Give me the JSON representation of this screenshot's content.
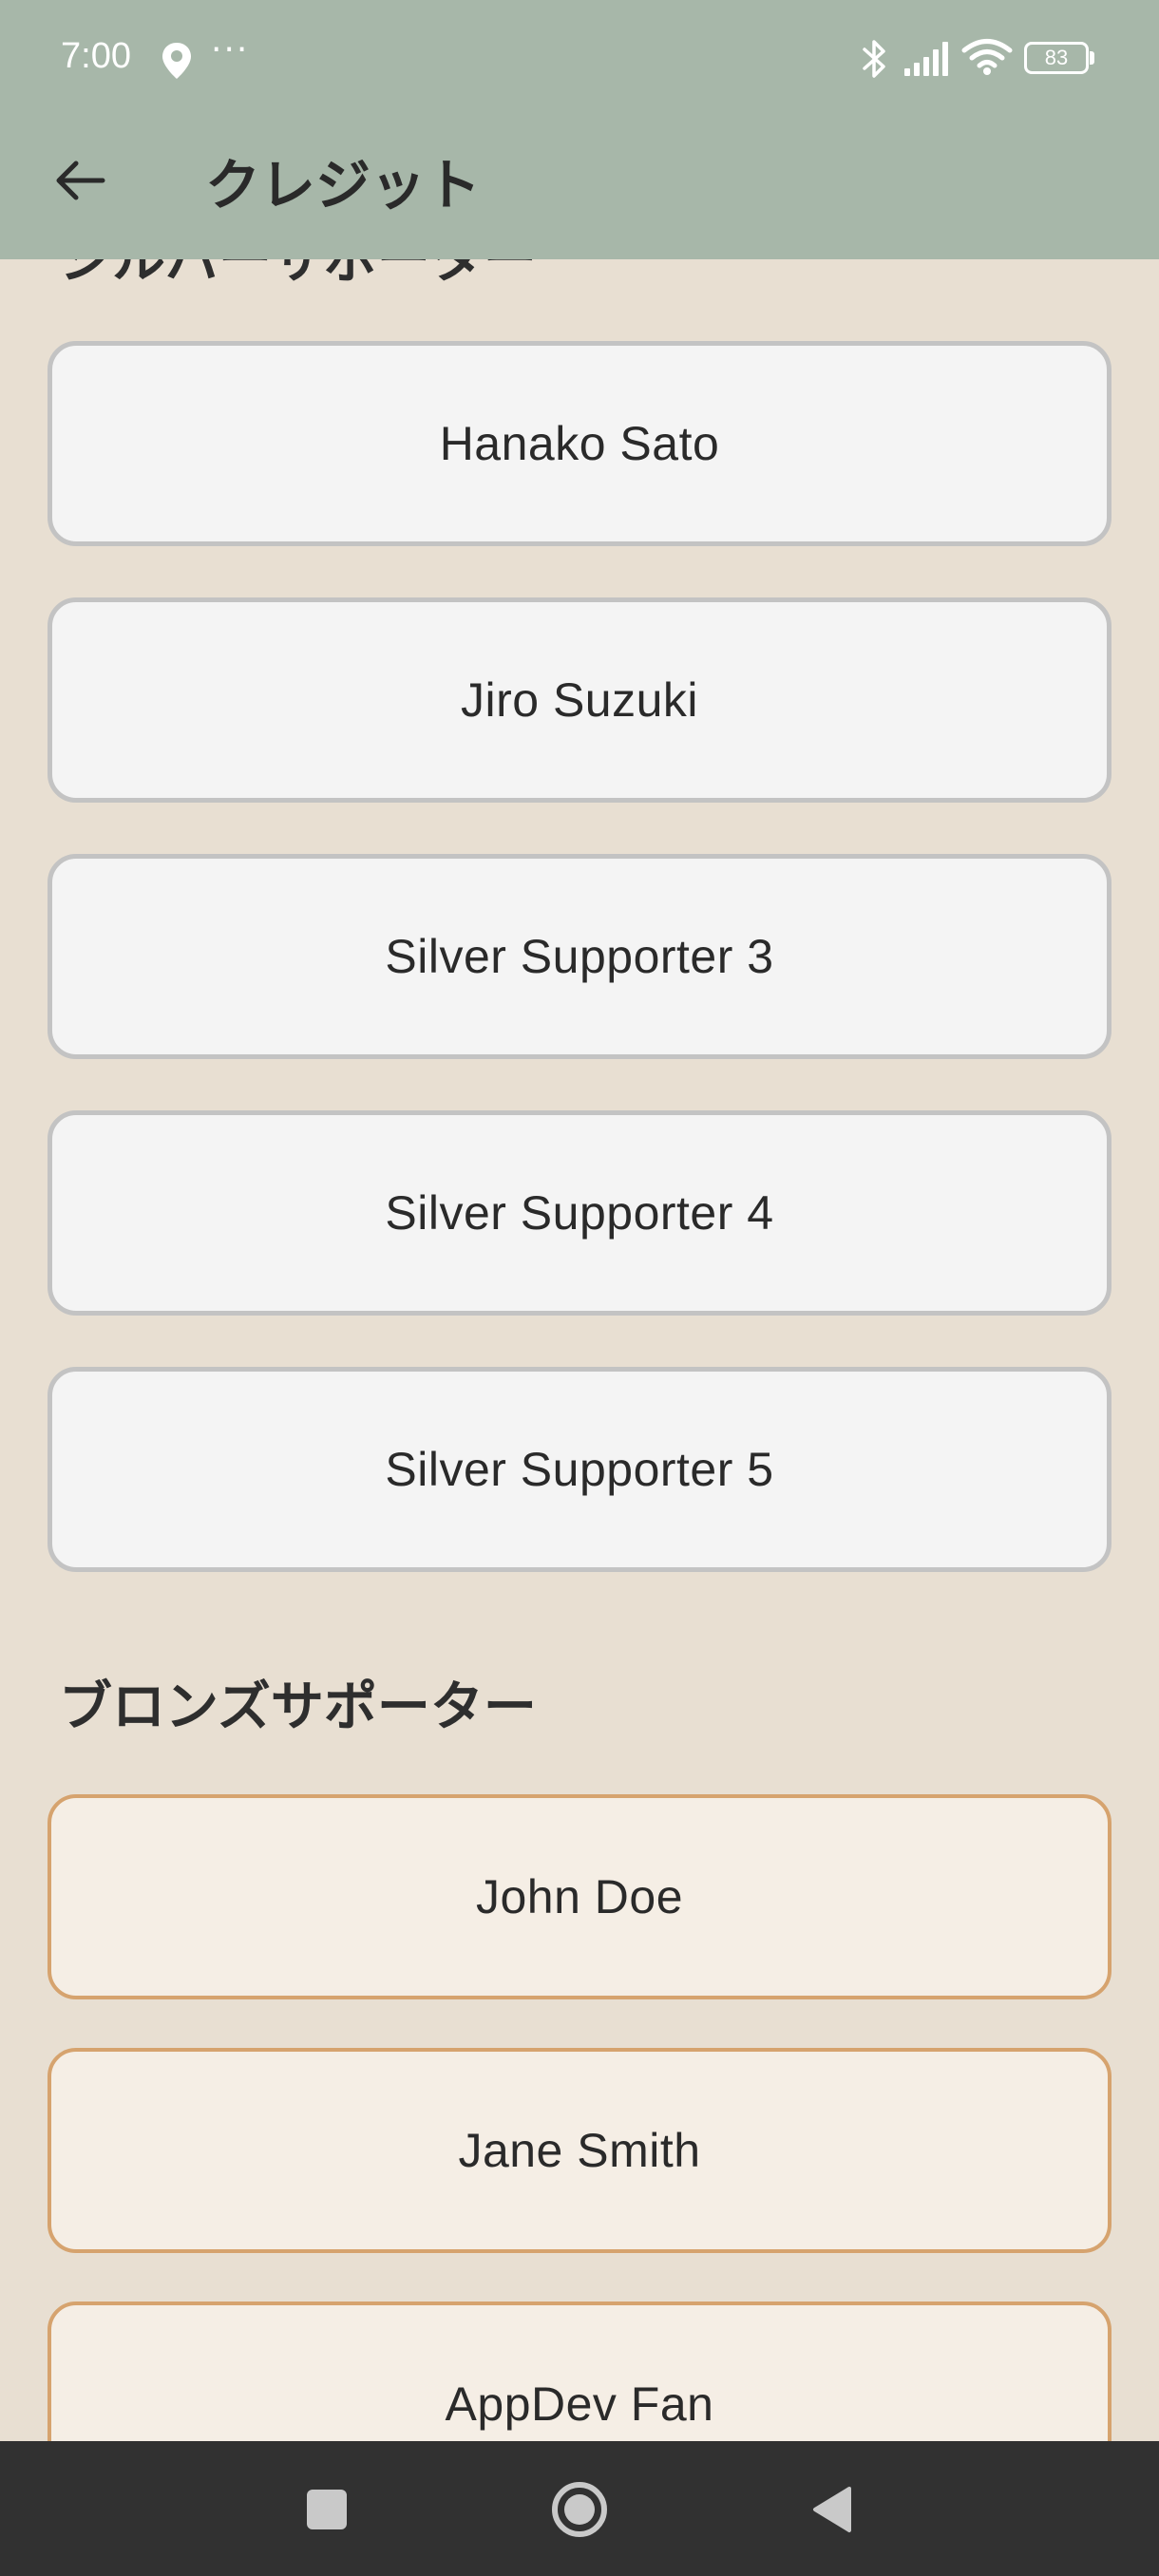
{
  "status_bar": {
    "time": "7:00",
    "extra": "···",
    "battery": "83",
    "icons": [
      "location-icon",
      "bluetooth-icon",
      "signal-icon",
      "wifi-icon",
      "battery-icon"
    ]
  },
  "app_bar": {
    "title": "クレジット",
    "back_icon": "arrow-left-icon"
  },
  "sections": {
    "silver": {
      "heading": "シルバーサポーター",
      "items": [
        {
          "name": "Hanako Sato"
        },
        {
          "name": "Jiro Suzuki"
        },
        {
          "name": "Silver Supporter 3"
        },
        {
          "name": "Silver Supporter 4"
        },
        {
          "name": "Silver Supporter 5"
        }
      ]
    },
    "bronze": {
      "heading": "ブロンズサポーター",
      "items": [
        {
          "name": "John Doe"
        },
        {
          "name": "Jane Smith"
        },
        {
          "name": "AppDev Fan"
        }
      ]
    }
  },
  "nav_bar": {
    "icons": [
      "recents-icon",
      "home-icon",
      "back-icon"
    ]
  },
  "colors": {
    "app_bar": "#a7b7a9",
    "background": "#e8dfd2",
    "silver_card": "#f4f4f4",
    "silver_border": "#c3c3c3",
    "bronze_card": "#f5eee5",
    "bronze_border": "#d6a36e",
    "nav_bar": "#313131"
  }
}
